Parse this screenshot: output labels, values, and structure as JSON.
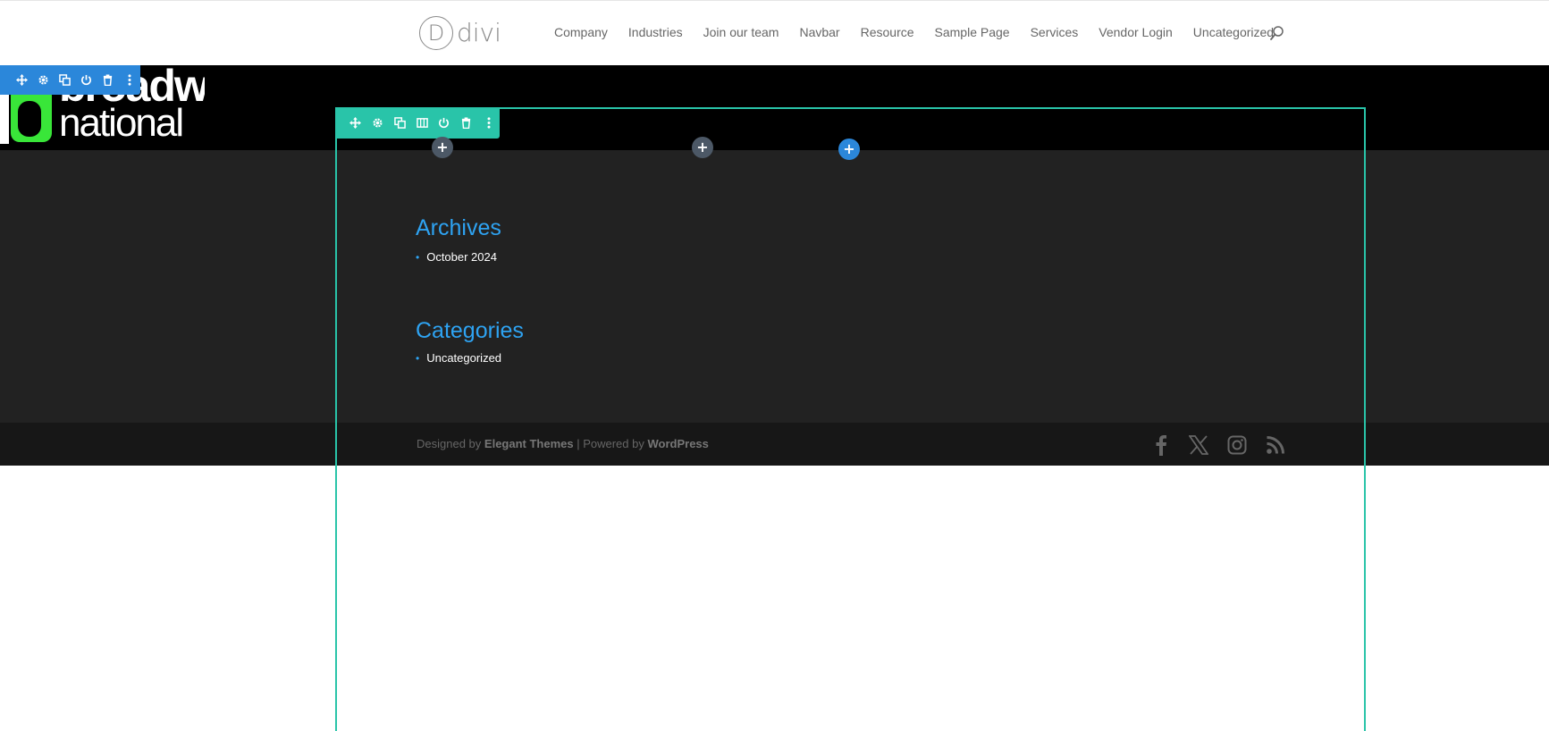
{
  "header": {
    "logo_mark": "D",
    "logo_text": "divi",
    "nav": [
      "Company",
      "Industries",
      "Join our team",
      "Navbar",
      "Resource",
      "Sample Page",
      "Services",
      "Vendor Login",
      "Uncategorized"
    ],
    "search_icon": "search-icon"
  },
  "brand_logo": {
    "line1": "broadway",
    "line2": "national"
  },
  "widgets": {
    "archives_title": "Archives",
    "archives_items": [
      "October 2024"
    ],
    "categories_title": "Categories",
    "categories_items": [
      "Uncategorized"
    ]
  },
  "footer": {
    "designed_by": "Designed by",
    "theme_author": "Elegant Themes",
    "separator": " | Powered by ",
    "platform": "WordPress",
    "social": [
      "facebook-icon",
      "x-icon",
      "instagram-icon",
      "rss-icon"
    ]
  },
  "builder": {
    "section_toolbar": [
      "move-icon",
      "settings-icon",
      "duplicate-icon",
      "power-icon",
      "trash-icon",
      "more-icon"
    ],
    "row_toolbar": [
      "move-icon",
      "settings-icon",
      "duplicate-icon",
      "columns-icon",
      "power-icon",
      "trash-icon",
      "more-icon"
    ],
    "add_label": "+"
  },
  "colors": {
    "accent": "#2ea3f2",
    "row_outline": "#29c4a9",
    "section_toolbar": "#2b87da",
    "dark_bg": "#222222",
    "bottom_bar": "#171717"
  }
}
